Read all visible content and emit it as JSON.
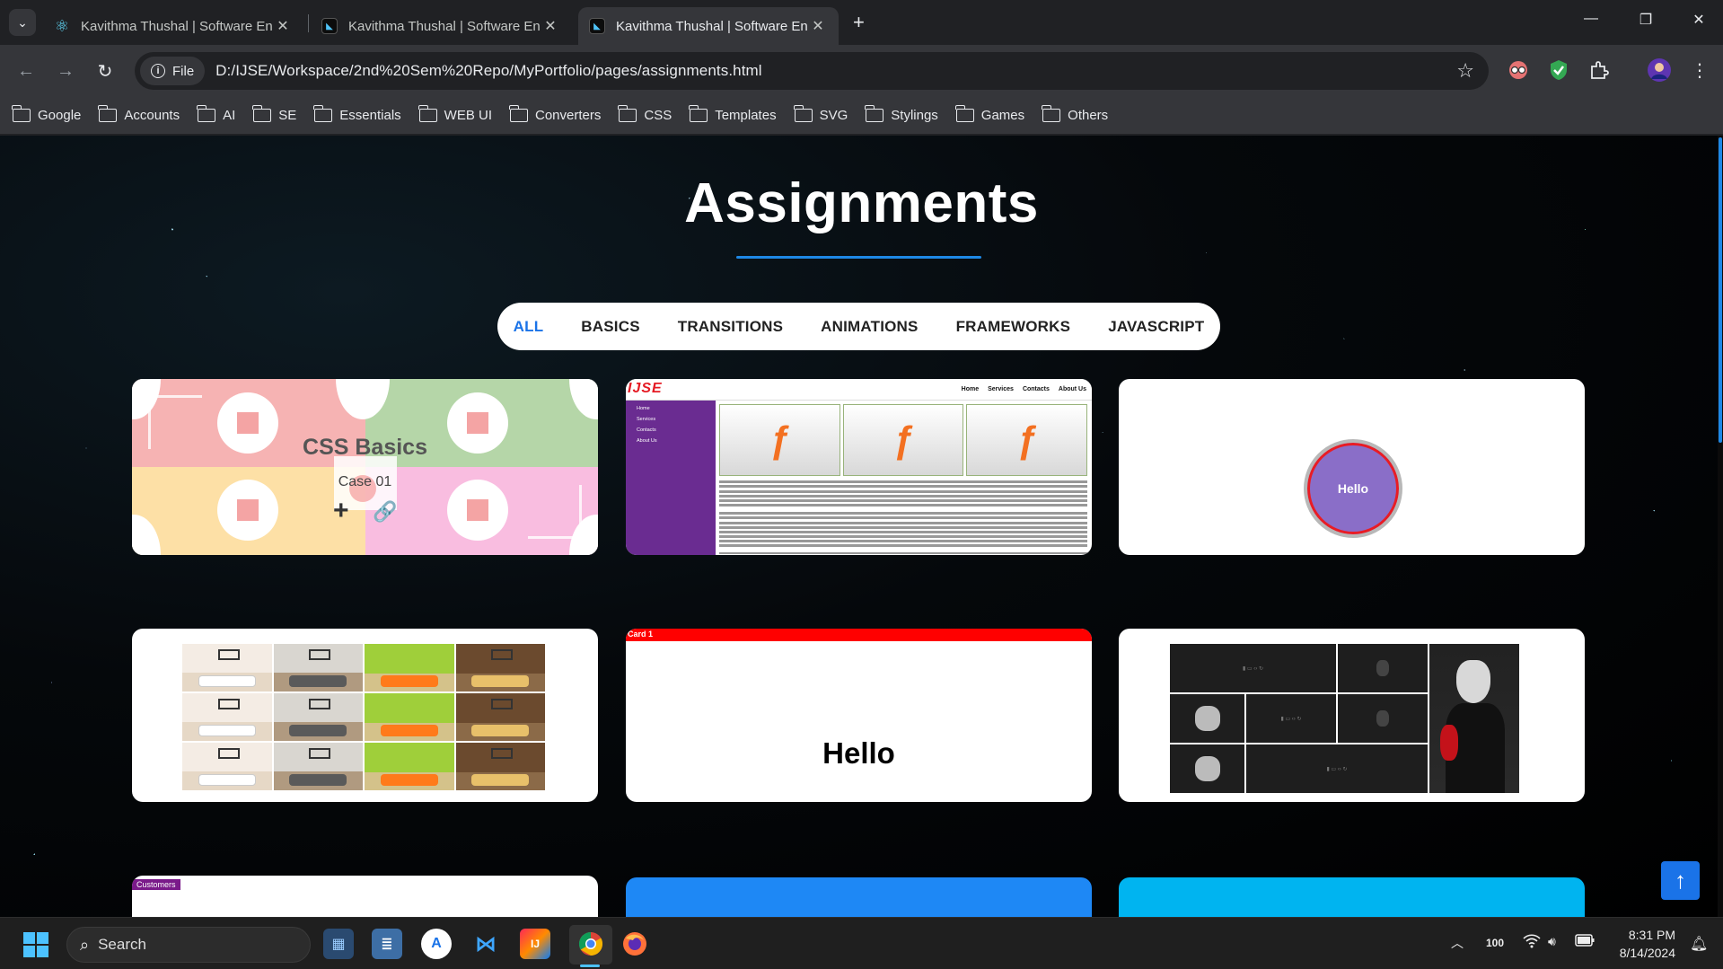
{
  "browser": {
    "tabs": [
      {
        "title": "Kavithma Thushal | Software Engineer",
        "favicon": "react-icon",
        "active": false
      },
      {
        "title": "Kavithma Thushal | Software Engineer",
        "favicon": "portfolio-icon",
        "active": false
      },
      {
        "title": "Kavithma Thushal | Software Engineer",
        "favicon": "portfolio-icon",
        "active": true
      }
    ],
    "close_glyph": "✕",
    "new_tab_glyph": "+",
    "address": {
      "chip_label": "File",
      "url": "D:/IJSE/Workspace/2nd%20Sem%20Repo/MyPortfolio/pages/assignments.html"
    },
    "bookmarks": [
      "Google",
      "Accounts",
      "AI",
      "SE",
      "Essentials",
      "WEB UI",
      "Converters",
      "CSS",
      "Templates",
      "SVG",
      "Stylings",
      "Games",
      "Others"
    ]
  },
  "page": {
    "title": "Assignments",
    "filters": [
      "ALL",
      "BASICS",
      "TRANSITIONS",
      "ANIMATIONS",
      "FRAMEWORKS",
      "JAVASCRIPT"
    ],
    "active_filter": "ALL",
    "accent_color": "#1e88e5",
    "cards": {
      "css_basics": {
        "title": "CSS Basics",
        "subtitle": "Case 01"
      },
      "ijse_site": {
        "logo": "IJSE",
        "nav": [
          "Home",
          "Services",
          "Contacts",
          "About Us"
        ],
        "side": [
          "Home",
          "Services",
          "Contacts",
          "About Us"
        ]
      },
      "hello_circle": {
        "label": "Hello"
      },
      "hello_card": {
        "bar_label": "Card 1",
        "text": "Hello"
      },
      "customers": {
        "label": "Customers"
      }
    },
    "scroll_top_glyph": "↑"
  },
  "taskbar": {
    "search_placeholder": "Search",
    "tray_battery": "100",
    "time": "8:31 PM",
    "date": "8/14/2024"
  }
}
